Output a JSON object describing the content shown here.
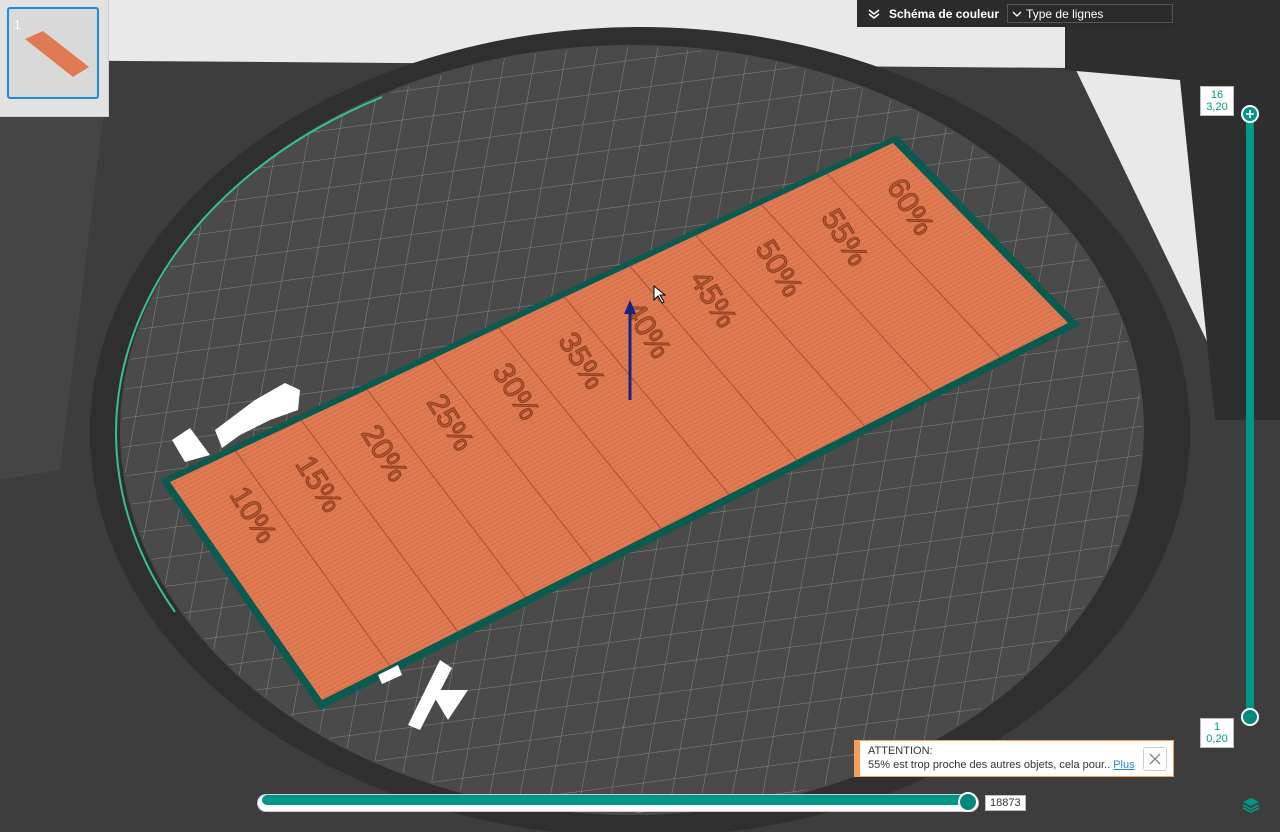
{
  "colors": {
    "accent": "#009688",
    "part": "#e07a52",
    "plate_border": "#0b5a50",
    "toolbar_bg": "#2b2b2b",
    "warning_border": "#f5a05a",
    "link": "#1e88e5",
    "axis_arrow": "#1a237e"
  },
  "thumbnail": {
    "number": "1"
  },
  "color_scheme": {
    "label": "Schéma de couleur",
    "selected": "Type de lignes"
  },
  "model": {
    "labels": [
      "10%",
      "15%",
      "20%",
      "25%",
      "30%",
      "35%",
      "40%",
      "45%",
      "50%",
      "55%",
      "60%"
    ]
  },
  "layer_slider": {
    "top_layer": "16",
    "top_height": "3,20",
    "bottom_layer": "1",
    "bottom_height": "0,20"
  },
  "move_slider": {
    "value": "18873",
    "progress": 1.0
  },
  "warning": {
    "title": "ATTENTION:",
    "message": "55% est trop proche des autres objets, cela pour..",
    "more_link": "Plus"
  },
  "icons": {
    "collapse": "chevron-down-icon",
    "dropdown": "chevron-down-icon",
    "close": "close-icon",
    "layers": "layers-icon",
    "add": "plus-icon"
  }
}
